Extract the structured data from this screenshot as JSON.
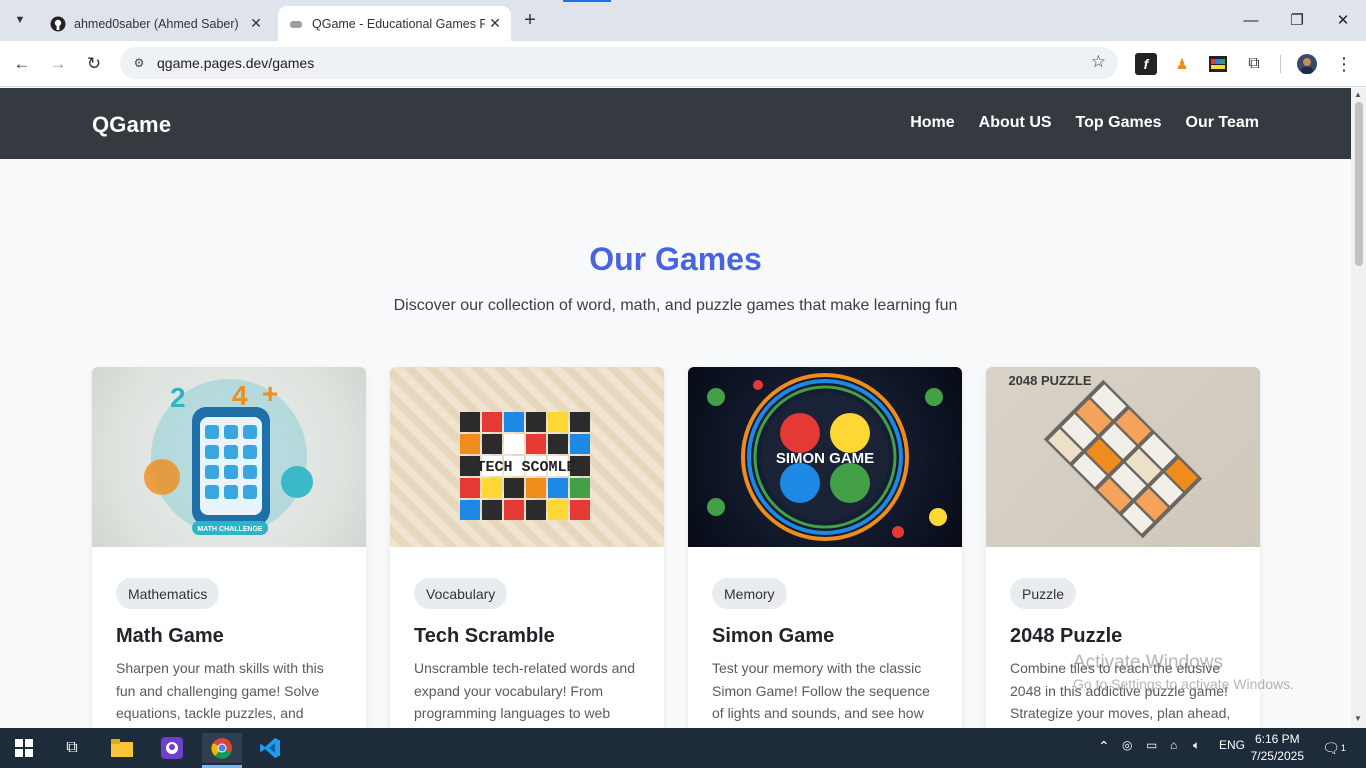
{
  "browser": {
    "tabs": [
      {
        "title": "ahmed0saber (Ahmed Saber)",
        "active": false
      },
      {
        "title": "QGame - Educational Games Pl",
        "active": true
      }
    ],
    "url": "qgame.pages.dev/games"
  },
  "site": {
    "brand": "QGame",
    "nav": [
      "Home",
      "About US",
      "Top Games",
      "Our Team"
    ],
    "heading": "Our Games",
    "subheading": "Discover our collection of word, math, and puzzle games that make learning fun"
  },
  "games": [
    {
      "tag": "Mathematics",
      "title": "Math Game",
      "description": "Sharpen your math skills with this fun and challenging game! Solve equations, tackle puzzles, and",
      "image_label": "MATH CHALLENGE"
    },
    {
      "tag": "Vocabulary",
      "title": "Tech Scramble",
      "description": "Unscramble tech-related words and expand your vocabulary! From programming languages to web",
      "image_label": "TECH SCOMLE"
    },
    {
      "tag": "Memory",
      "title": "Simon Game",
      "description": "Test your memory with the classic Simon Game! Follow the sequence of lights and sounds, and see how",
      "image_label": "SIMON GAME"
    },
    {
      "tag": "Puzzle",
      "title": "2048 Puzzle",
      "description": "Combine tiles to reach the elusive 2048 in this addictive puzzle game! Strategize your moves, plan ahead,",
      "image_label": "2048 PUZZLE"
    }
  ],
  "watermark": {
    "line1": "Activate Windows",
    "line2": "Go to Settings to activate Windows."
  },
  "taskbar": {
    "language": "ENG",
    "time": "6:16 PM",
    "date": "7/25/2025",
    "notification_count": "1"
  },
  "colors": {
    "accent": "#4a63e0",
    "navbar": "#343a40",
    "taskbar": "#1d2b3a"
  }
}
